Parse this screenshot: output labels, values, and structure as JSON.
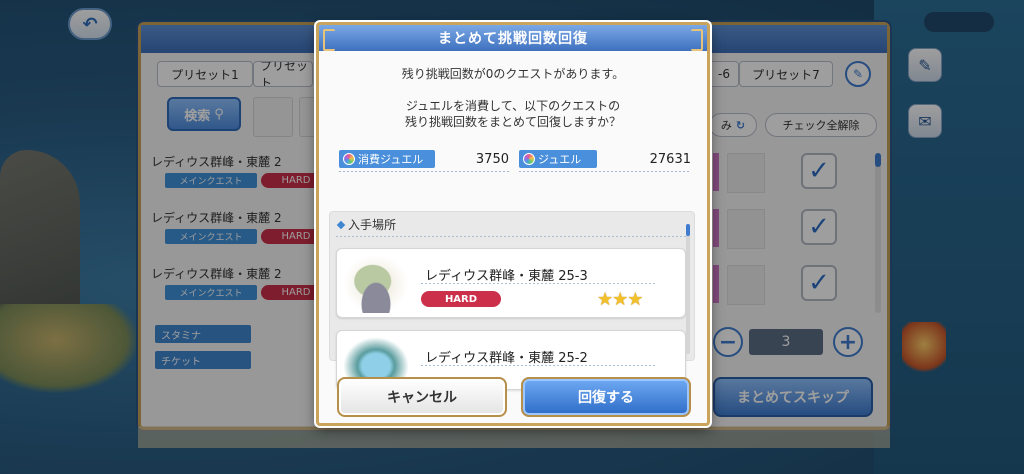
{
  "background": {
    "presets": [
      "プリセット1",
      "プリセット",
      "-6",
      "プリセット7"
    ],
    "search_label": "検索",
    "sort_label": "み",
    "clear_label": "チェック全解除",
    "quests": [
      {
        "title": "レディウス群峰・東麓 2",
        "category": "メインクエスト",
        "difficulty": "HARD"
      },
      {
        "title": "レディウス群峰・東麓 2",
        "category": "メインクエスト",
        "difficulty": "HARD"
      },
      {
        "title": "レディウス群峰・東麓 2",
        "category": "メインクエスト",
        "difficulty": "HARD"
      }
    ],
    "stamina_label": "スタミナ",
    "ticket_label": "チケット",
    "skip_count": "3",
    "skip_button": "まとめてスキップ"
  },
  "dialog": {
    "title": "まとめて挑戦回数回復",
    "message_line1": "残り挑戦回数が0のクエストがあります。",
    "message_line2": "ジュエルを消費して、以下のクエストの",
    "message_line3": "残り挑戦回数をまとめて回復しますか？",
    "cost_label": "消費ジュエル",
    "cost_value": "3750",
    "jewel_label": "ジュエル",
    "jewel_value": "27631",
    "source_header": "入手場所",
    "quests": [
      {
        "title": "レディウス群峰・東麓 25-3",
        "difficulty": "HARD",
        "stars": "★★★"
      },
      {
        "title": "レディウス群峰・東麓 25-2"
      }
    ],
    "cancel_button": "キャンセル",
    "confirm_button": "回復する"
  },
  "colors": {
    "accent": "#3f7cd0",
    "hard": "#cc2f4a",
    "gold_border": "#c9a45a"
  }
}
